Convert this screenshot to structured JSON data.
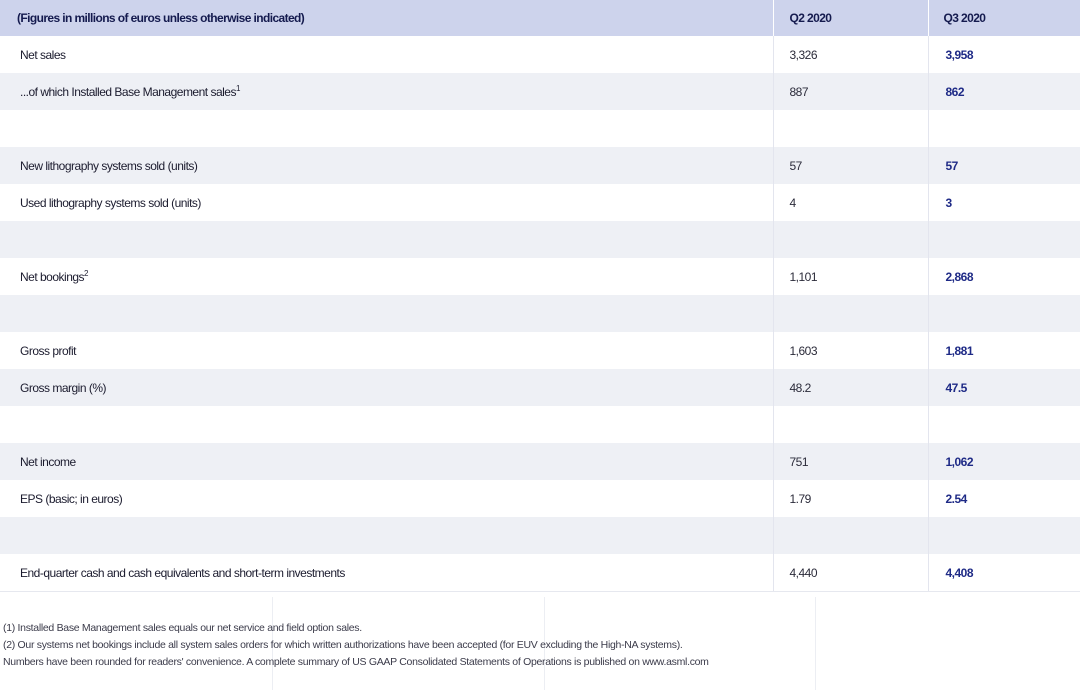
{
  "table": {
    "header": {
      "label": "(Figures in millions of euros unless otherwise indicated)",
      "q2": "Q2 2020",
      "q3": "Q3 2020"
    },
    "rows": [
      {
        "label": "Net sales",
        "sup": "",
        "q2": "3,326",
        "q3": "3,958"
      },
      {
        "label": "...of which Installed Base Management sales",
        "sup": "1",
        "q2": "887",
        "q3": "862"
      },
      {
        "label": "",
        "sup": "",
        "q2": "",
        "q3": ""
      },
      {
        "label": "New lithography systems sold (units)",
        "sup": "",
        "q2": "57",
        "q3": "57"
      },
      {
        "label": "Used lithography systems sold (units)",
        "sup": "",
        "q2": "4",
        "q3": "3"
      },
      {
        "label": "",
        "sup": "",
        "q2": "",
        "q3": ""
      },
      {
        "label": "Net bookings",
        "sup": "2",
        "q2": "1,101",
        "q3": "2,868"
      },
      {
        "label": "",
        "sup": "",
        "q2": "",
        "q3": ""
      },
      {
        "label": "Gross profit",
        "sup": "",
        "q2": "1,603",
        "q3": "1,881"
      },
      {
        "label": "Gross margin (%)",
        "sup": "",
        "q2": "48.2",
        "q3": "47.5"
      },
      {
        "label": "",
        "sup": "",
        "q2": "",
        "q3": ""
      },
      {
        "label": "Net income",
        "sup": "",
        "q2": "751",
        "q3": "1,062"
      },
      {
        "label": "EPS (basic; in euros)",
        "sup": "",
        "q2": "1.79",
        "q3": "2.54"
      },
      {
        "label": "",
        "sup": "",
        "q2": "",
        "q3": ""
      },
      {
        "label": "End-quarter cash and cash equivalents and short-term investments",
        "sup": "",
        "q2": "4,440",
        "q3": "4,408"
      }
    ]
  },
  "footnotes": [
    "(1) Installed Base Management sales equals our net service and field option sales.",
    "(2) Our systems net bookings include all system sales orders for which written authorizations have been accepted (for EUV excluding the High-NA systems).",
    "Numbers have been rounded for readers' convenience. A complete summary of US GAAP Consolidated Statements of Operations is published on www.asml.com"
  ]
}
